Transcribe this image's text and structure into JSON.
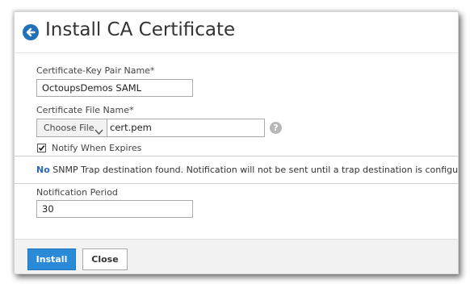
{
  "dialog": {
    "title": "Install CA Certificate"
  },
  "form": {
    "pair_name_label": "Certificate-Key Pair Name*",
    "pair_name_value": "OctoupsDemos SAML",
    "file_name_label": "Certificate File Name*",
    "choose_file_label": "Choose File",
    "file_name_value": "cert.pem",
    "help_glyph": "?",
    "notify_label": "Notify When Expires",
    "notify_checked": true,
    "notice_strong": "No",
    "notice_text": " SNMP Trap destination found. Notification will not be sent until a trap destination is configured.",
    "period_label": "Notification Period",
    "period_value": "30"
  },
  "footer": {
    "install_label": "Install",
    "close_label": "Close"
  },
  "colors": {
    "accent": "#2a8ad8",
    "back_icon": "#2372b9",
    "notice_highlight": "#2c68b5"
  },
  "icons": [
    "back-arrow-icon",
    "chevron-down-icon",
    "help-icon",
    "checkmark-icon"
  ]
}
